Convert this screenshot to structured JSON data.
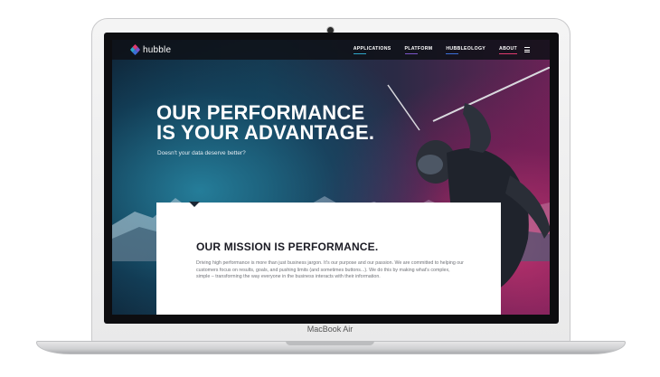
{
  "device": {
    "label": "MacBook Air"
  },
  "site": {
    "logo_text": "hubble",
    "nav": {
      "items": [
        {
          "label": "APPLICATIONS",
          "accent": "#2ea6c9"
        },
        {
          "label": "PLATFORM",
          "accent": "#7a55c8"
        },
        {
          "label": "HUBBLEOLOGY",
          "accent": "#3b6fd9"
        },
        {
          "label": "ABOUT",
          "accent": "#e03a6f"
        }
      ],
      "menu_icon": "hamburger-icon"
    },
    "hero": {
      "title_line1": "OUR PERFORMANCE",
      "title_line2": "IS YOUR ADVANTAGE.",
      "subtitle": "Doesn't your data deserve better?"
    },
    "mission": {
      "title": "OUR MISSION IS PERFORMANCE.",
      "body": "Driving high performance is more than just business jargon. It's our purpose and our passion. We are committed to helping our customers focus on results, goals, and pushing limits (and sometimes buttons...). We do this by making what's complex, simple – transforming the way everyone in the business interacts with their information."
    }
  },
  "colors": {
    "accent_teal": "#2ea6c9",
    "accent_pink": "#e03a6f",
    "card_title": "#1b1b24"
  }
}
